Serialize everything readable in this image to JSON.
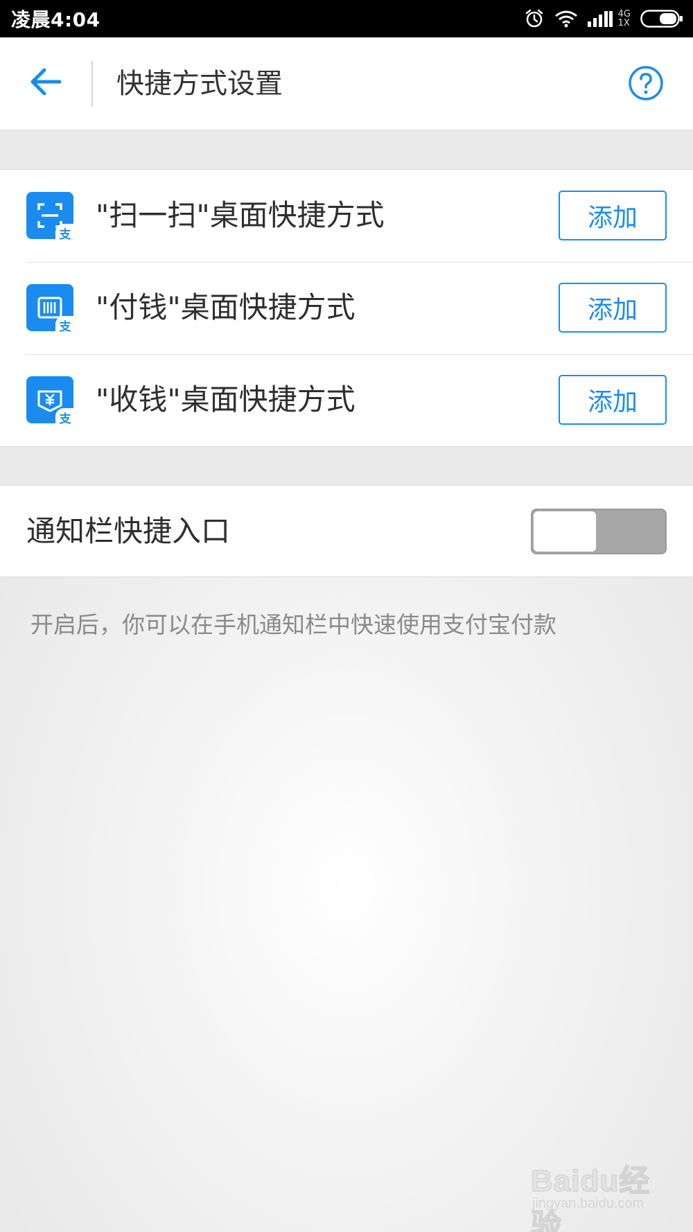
{
  "status_bar": {
    "time": "凌晨4:04",
    "network_top": "4G",
    "network_bottom": "1X",
    "icons": [
      "alarm-icon",
      "wifi-icon",
      "signal-icon",
      "battery-icon"
    ]
  },
  "header": {
    "title": "快捷方式设置",
    "back_icon": "arrow-left-icon",
    "help_icon": "help-circle-icon"
  },
  "shortcuts": {
    "items": [
      {
        "label": "\"扫一扫\"桌面快捷方式",
        "button": "添加",
        "icon": "scan-icon",
        "badge": "支"
      },
      {
        "label": "\"付钱\"桌面快捷方式",
        "button": "添加",
        "icon": "barcode-icon",
        "badge": "支"
      },
      {
        "label": "\"收钱\"桌面快捷方式",
        "button": "添加",
        "icon": "receive-money-icon",
        "badge": "支"
      }
    ]
  },
  "notification": {
    "label": "通知栏快捷入口",
    "enabled": false,
    "helper": "开启后，你可以在手机通知栏中快速使用支付宝付款"
  },
  "watermark": {
    "main": "Baidu经验",
    "sub": "jingyan.baidu.com"
  },
  "colors": {
    "accent": "#1a8cf0",
    "toggle_off": "#a7a7a7",
    "background": "#eaeaea"
  }
}
